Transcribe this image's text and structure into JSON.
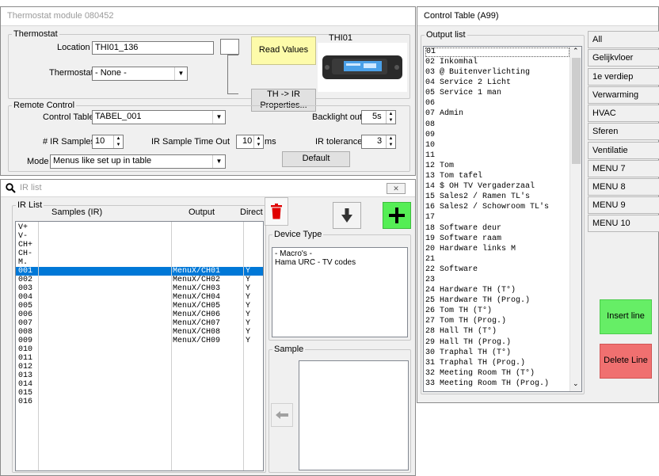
{
  "thermostat_window": {
    "title": "Thermostat module 080452",
    "thermostat_group": {
      "legend": "Thermostat",
      "location_label": "Location",
      "location_value": "THI01_136",
      "thermostat_label": "Thermostat",
      "thermostat_value": "- None -",
      "read_values_label": "Read Values",
      "device_title": "THI01",
      "th_ir_label": "TH -> IR Properties..."
    },
    "remote_group": {
      "legend": "Remote Control",
      "control_table_label": "Control Table",
      "control_table_value": "TABEL_001",
      "backlight_label": "Backlight out",
      "backlight_value": "5s",
      "ir_samples_label": "# IR Samples",
      "ir_samples_value": "10",
      "ir_timeout_label": "IR Sample Time Out",
      "ir_timeout_value": "10",
      "ir_timeout_unit": "ms",
      "ir_tolerance_label": "IR tolerance",
      "ir_tolerance_value": "3",
      "mode_label": "Mode",
      "mode_value": "Menus like set up in table",
      "default_label": "Default"
    }
  },
  "ir_window": {
    "title": "IR list",
    "list_legend": "IR List",
    "col_samples": "Samples (IR)",
    "col_output": "Output",
    "col_direct": "Direct",
    "rows": [
      {
        "id": "V+",
        "output": "",
        "direct": "",
        "selected": false
      },
      {
        "id": "V-",
        "output": "",
        "direct": "",
        "selected": false
      },
      {
        "id": "CH+",
        "output": "",
        "direct": "",
        "selected": false
      },
      {
        "id": "CH-",
        "output": "",
        "direct": "",
        "selected": false
      },
      {
        "id": "M.",
        "output": "",
        "direct": "",
        "selected": false
      },
      {
        "id": "001",
        "output": "MenuX/CH01",
        "direct": "Y",
        "selected": true
      },
      {
        "id": "002",
        "output": "MenuX/CH02",
        "direct": "Y",
        "selected": false
      },
      {
        "id": "003",
        "output": "MenuX/CH03",
        "direct": "Y",
        "selected": false
      },
      {
        "id": "004",
        "output": "MenuX/CH04",
        "direct": "Y",
        "selected": false
      },
      {
        "id": "005",
        "output": "MenuX/CH05",
        "direct": "Y",
        "selected": false
      },
      {
        "id": "006",
        "output": "MenuX/CH06",
        "direct": "Y",
        "selected": false
      },
      {
        "id": "007",
        "output": "MenuX/CH07",
        "direct": "Y",
        "selected": false
      },
      {
        "id": "008",
        "output": "MenuX/CH08",
        "direct": "Y",
        "selected": false
      },
      {
        "id": "009",
        "output": "MenuX/CH09",
        "direct": "Y",
        "selected": false
      },
      {
        "id": "010",
        "output": "",
        "direct": "",
        "selected": false
      },
      {
        "id": "011",
        "output": "",
        "direct": "",
        "selected": false
      },
      {
        "id": "012",
        "output": "",
        "direct": "",
        "selected": false
      },
      {
        "id": "013",
        "output": "",
        "direct": "",
        "selected": false
      },
      {
        "id": "014",
        "output": "",
        "direct": "",
        "selected": false
      },
      {
        "id": "015",
        "output": "",
        "direct": "",
        "selected": false
      },
      {
        "id": "016",
        "output": "",
        "direct": "",
        "selected": false
      }
    ],
    "device_type_legend": "Device Type",
    "device_types": [
      "- Macro's -",
      "Hama URC - TV codes"
    ],
    "sample_legend": "Sample",
    "delete_icon": "trash-icon",
    "down_icon": "arrow-down-icon",
    "add_icon": "plus-icon",
    "left_icon": "arrow-left-icon",
    "close_label": "X"
  },
  "control_window": {
    "title": "Control Table (A99)",
    "output_legend": "Output list",
    "lines": [
      "01",
      "02 Inkomhal",
      "03 @ Buitenverlichting",
      "04 Service 2 Licht",
      "05 Service 1 man",
      "06",
      "07 Admin",
      "08",
      "09",
      "10",
      "11",
      "12 Tom",
      "13 Tom tafel",
      "14 $ OH TV Vergaderzaal",
      "15 Sales2 / Ramen TL's",
      "16 Sales2 / Schowroom TL's",
      "17",
      "18 Software deur",
      "19 Software raam",
      "20 Hardware links M",
      "21",
      "22 Software",
      "23",
      "24 Hardware TH (T°)",
      "25 Hardware TH (Prog.)",
      "26 Tom TH (T°)",
      "27 Tom TH (Prog.)",
      "28 Hall TH (T°)",
      "29 Hall TH (Prog.)",
      "30 Traphal TH (T°)",
      "31 Traphal TH (Prog.)",
      "32 Meeting Room TH (T°)",
      "33 Meeting Room TH (Prog.)"
    ],
    "categories": [
      "All",
      "Gelijkvloer",
      "1e verdiep",
      "Verwarming",
      "HVAC",
      "Sferen",
      "Ventilatie",
      "MENU 7",
      "MENU 8",
      "MENU 9",
      "MENU 10"
    ],
    "insert_label": "Insert line",
    "delete_label": "Delete Line",
    "insert_color": "#66ee66",
    "delete_color": "#f07070"
  }
}
